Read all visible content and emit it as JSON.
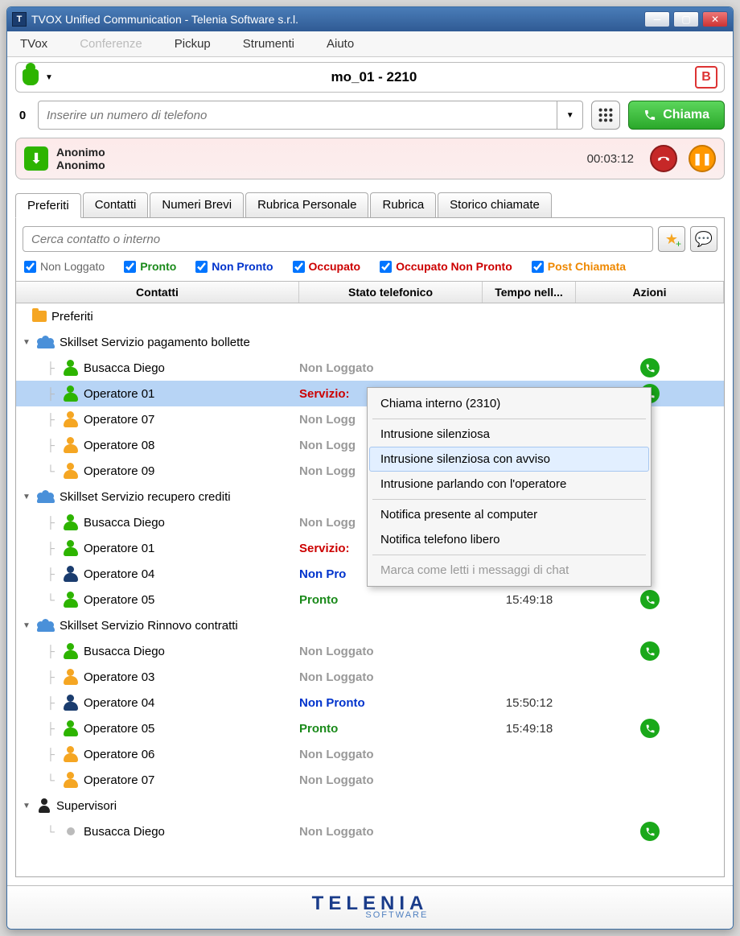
{
  "window": {
    "title": "TVOX Unified Communication - Telenia Software s.r.l.",
    "icon_letter": "T"
  },
  "menu": {
    "tvox": "TVox",
    "conferenze": "Conferenze",
    "pickup": "Pickup",
    "strumenti": "Strumenti",
    "aiuto": "Aiuto"
  },
  "topbar": {
    "title": "mo_01 - 2210",
    "b": "B"
  },
  "dial": {
    "zero": "0",
    "placeholder": "Inserire un numero di telefono",
    "call_label": "Chiama"
  },
  "call": {
    "name1": "Anonimo",
    "name2": "Anonimo",
    "time": "00:03:12"
  },
  "tabs": {
    "preferiti": "Preferiti",
    "contatti": "Contatti",
    "numeri": "Numeri Brevi",
    "rubricap": "Rubrica Personale",
    "rubrica": "Rubrica",
    "storico": "Storico chiamate"
  },
  "search": {
    "placeholder": "Cerca contatto o interno"
  },
  "filters": {
    "nl": "Non Loggato",
    "p": "Pronto",
    "np": "Non Pronto",
    "o": "Occupato",
    "onp": "Occupato Non Pronto",
    "pc": "Post Chiamata"
  },
  "columns": {
    "contatti": "Contatti",
    "stato": "Stato telefonico",
    "tempo": "Tempo nell...",
    "azioni": "Azioni"
  },
  "tree": {
    "root": "Preferiti",
    "g1": {
      "name": "Skillset Servizio pagamento bollette",
      "rows": [
        {
          "name": "Busacca Diego",
          "status": "Non Loggato",
          "sc": "gray",
          "pc": "green",
          "act": true
        },
        {
          "name": "Operatore 01",
          "status": "Servizio:",
          "sc": "red",
          "pc": "green",
          "act": true,
          "sel": true
        },
        {
          "name": "Operatore 07",
          "status": "Non Logg",
          "sc": "gray",
          "pc": "orange"
        },
        {
          "name": "Operatore 08",
          "status": "Non Logg",
          "sc": "gray",
          "pc": "orange"
        },
        {
          "name": "Operatore 09",
          "status": "Non Logg",
          "sc": "gray",
          "pc": "orange"
        }
      ]
    },
    "g2": {
      "name": "Skillset Servizio recupero crediti",
      "rows": [
        {
          "name": "Busacca Diego",
          "status": "Non Logg",
          "sc": "gray",
          "pc": "green"
        },
        {
          "name": "Operatore 01",
          "status": "Servizio:",
          "sc": "red",
          "pc": "green"
        },
        {
          "name": "Operatore 04",
          "status": "Non Pro",
          "sc": "blue",
          "pc": "navy"
        },
        {
          "name": "Operatore 05",
          "status": "Pronto",
          "sc": "green",
          "pc": "green",
          "time": "15:49:18",
          "act": true
        }
      ]
    },
    "g3": {
      "name": "Skillset Servizio Rinnovo contratti",
      "rows": [
        {
          "name": "Busacca Diego",
          "status": "Non Loggato",
          "sc": "gray",
          "pc": "green",
          "act": true
        },
        {
          "name": "Operatore 03",
          "status": "Non Loggato",
          "sc": "gray",
          "pc": "orange"
        },
        {
          "name": "Operatore 04",
          "status": "Non Pronto",
          "sc": "blue",
          "pc": "navy",
          "time": "15:50:12"
        },
        {
          "name": "Operatore 05",
          "status": "Pronto",
          "sc": "green",
          "pc": "green",
          "time": "15:49:18",
          "act": true
        },
        {
          "name": "Operatore 06",
          "status": "Non Loggato",
          "sc": "gray",
          "pc": "orange"
        },
        {
          "name": "Operatore 07",
          "status": "Non Loggato",
          "sc": "gray",
          "pc": "orange"
        }
      ]
    },
    "g4": {
      "name": "Supervisori",
      "rows": [
        {
          "name": "Busacca Diego",
          "status": "Non Loggato",
          "sc": "gray",
          "pc": "gray",
          "act": true,
          "dot": true
        }
      ]
    }
  },
  "context": {
    "chiama": "Chiama interno (2310)",
    "intr_sil": "Intrusione silenziosa",
    "intr_sil_avv": "Intrusione silenziosa con avviso",
    "intr_parl": "Intrusione parlando con l'operatore",
    "not_pres": "Notifica presente al computer",
    "not_tel": "Notifica telefono libero",
    "marca": "Marca come letti i messaggi di chat"
  },
  "logo": {
    "main": "TELENIA",
    "sub": "SOFTWARE"
  }
}
